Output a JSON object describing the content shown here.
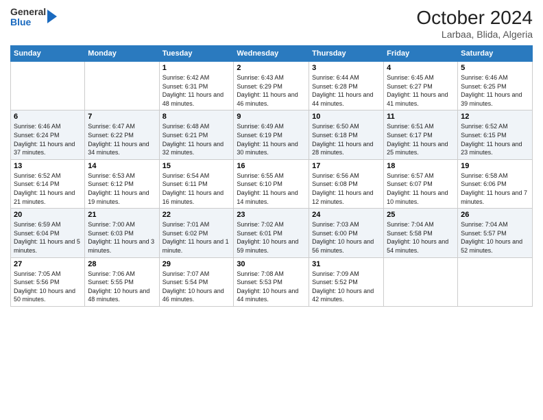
{
  "logo": {
    "general": "General",
    "blue": "Blue"
  },
  "title": "October 2024",
  "subtitle": "Larbaa, Blida, Algeria",
  "days_header": [
    "Sunday",
    "Monday",
    "Tuesday",
    "Wednesday",
    "Thursday",
    "Friday",
    "Saturday"
  ],
  "weeks": [
    [
      {
        "num": "",
        "info": ""
      },
      {
        "num": "",
        "info": ""
      },
      {
        "num": "1",
        "info": "Sunrise: 6:42 AM\nSunset: 6:31 PM\nDaylight: 11 hours and 48 minutes."
      },
      {
        "num": "2",
        "info": "Sunrise: 6:43 AM\nSunset: 6:29 PM\nDaylight: 11 hours and 46 minutes."
      },
      {
        "num": "3",
        "info": "Sunrise: 6:44 AM\nSunset: 6:28 PM\nDaylight: 11 hours and 44 minutes."
      },
      {
        "num": "4",
        "info": "Sunrise: 6:45 AM\nSunset: 6:27 PM\nDaylight: 11 hours and 41 minutes."
      },
      {
        "num": "5",
        "info": "Sunrise: 6:46 AM\nSunset: 6:25 PM\nDaylight: 11 hours and 39 minutes."
      }
    ],
    [
      {
        "num": "6",
        "info": "Sunrise: 6:46 AM\nSunset: 6:24 PM\nDaylight: 11 hours and 37 minutes."
      },
      {
        "num": "7",
        "info": "Sunrise: 6:47 AM\nSunset: 6:22 PM\nDaylight: 11 hours and 34 minutes."
      },
      {
        "num": "8",
        "info": "Sunrise: 6:48 AM\nSunset: 6:21 PM\nDaylight: 11 hours and 32 minutes."
      },
      {
        "num": "9",
        "info": "Sunrise: 6:49 AM\nSunset: 6:19 PM\nDaylight: 11 hours and 30 minutes."
      },
      {
        "num": "10",
        "info": "Sunrise: 6:50 AM\nSunset: 6:18 PM\nDaylight: 11 hours and 28 minutes."
      },
      {
        "num": "11",
        "info": "Sunrise: 6:51 AM\nSunset: 6:17 PM\nDaylight: 11 hours and 25 minutes."
      },
      {
        "num": "12",
        "info": "Sunrise: 6:52 AM\nSunset: 6:15 PM\nDaylight: 11 hours and 23 minutes."
      }
    ],
    [
      {
        "num": "13",
        "info": "Sunrise: 6:52 AM\nSunset: 6:14 PM\nDaylight: 11 hours and 21 minutes."
      },
      {
        "num": "14",
        "info": "Sunrise: 6:53 AM\nSunset: 6:12 PM\nDaylight: 11 hours and 19 minutes."
      },
      {
        "num": "15",
        "info": "Sunrise: 6:54 AM\nSunset: 6:11 PM\nDaylight: 11 hours and 16 minutes."
      },
      {
        "num": "16",
        "info": "Sunrise: 6:55 AM\nSunset: 6:10 PM\nDaylight: 11 hours and 14 minutes."
      },
      {
        "num": "17",
        "info": "Sunrise: 6:56 AM\nSunset: 6:08 PM\nDaylight: 11 hours and 12 minutes."
      },
      {
        "num": "18",
        "info": "Sunrise: 6:57 AM\nSunset: 6:07 PM\nDaylight: 11 hours and 10 minutes."
      },
      {
        "num": "19",
        "info": "Sunrise: 6:58 AM\nSunset: 6:06 PM\nDaylight: 11 hours and 7 minutes."
      }
    ],
    [
      {
        "num": "20",
        "info": "Sunrise: 6:59 AM\nSunset: 6:04 PM\nDaylight: 11 hours and 5 minutes."
      },
      {
        "num": "21",
        "info": "Sunrise: 7:00 AM\nSunset: 6:03 PM\nDaylight: 11 hours and 3 minutes."
      },
      {
        "num": "22",
        "info": "Sunrise: 7:01 AM\nSunset: 6:02 PM\nDaylight: 11 hours and 1 minute."
      },
      {
        "num": "23",
        "info": "Sunrise: 7:02 AM\nSunset: 6:01 PM\nDaylight: 10 hours and 59 minutes."
      },
      {
        "num": "24",
        "info": "Sunrise: 7:03 AM\nSunset: 6:00 PM\nDaylight: 10 hours and 56 minutes."
      },
      {
        "num": "25",
        "info": "Sunrise: 7:04 AM\nSunset: 5:58 PM\nDaylight: 10 hours and 54 minutes."
      },
      {
        "num": "26",
        "info": "Sunrise: 7:04 AM\nSunset: 5:57 PM\nDaylight: 10 hours and 52 minutes."
      }
    ],
    [
      {
        "num": "27",
        "info": "Sunrise: 7:05 AM\nSunset: 5:56 PM\nDaylight: 10 hours and 50 minutes."
      },
      {
        "num": "28",
        "info": "Sunrise: 7:06 AM\nSunset: 5:55 PM\nDaylight: 10 hours and 48 minutes."
      },
      {
        "num": "29",
        "info": "Sunrise: 7:07 AM\nSunset: 5:54 PM\nDaylight: 10 hours and 46 minutes."
      },
      {
        "num": "30",
        "info": "Sunrise: 7:08 AM\nSunset: 5:53 PM\nDaylight: 10 hours and 44 minutes."
      },
      {
        "num": "31",
        "info": "Sunrise: 7:09 AM\nSunset: 5:52 PM\nDaylight: 10 hours and 42 minutes."
      },
      {
        "num": "",
        "info": ""
      },
      {
        "num": "",
        "info": ""
      }
    ]
  ]
}
